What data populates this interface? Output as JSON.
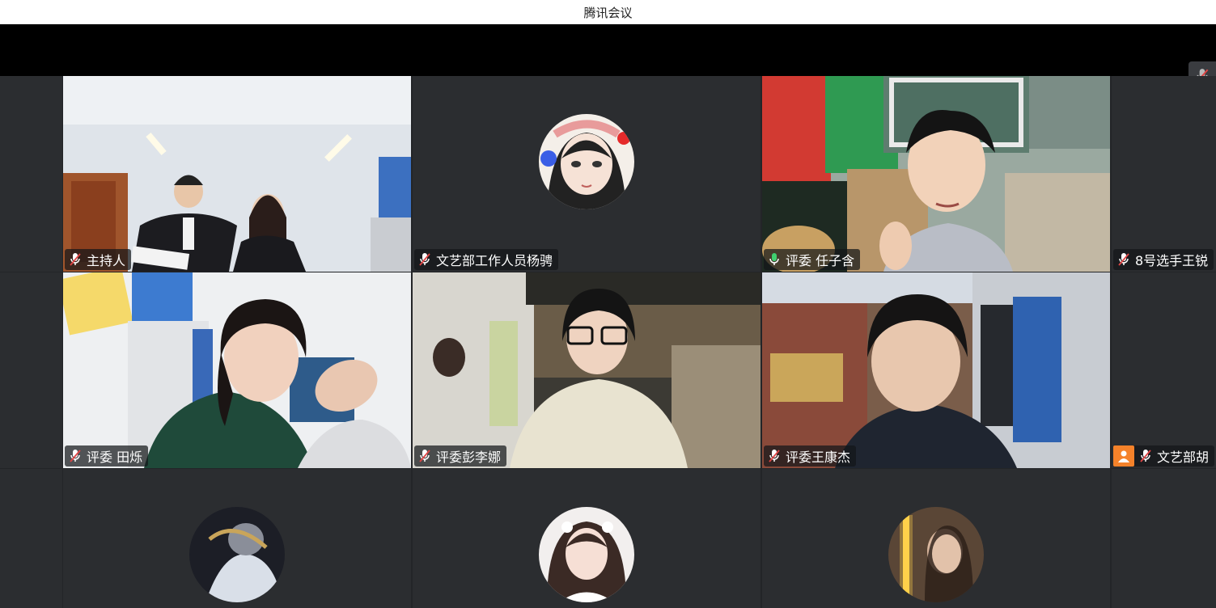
{
  "app": {
    "title": "腾讯会议"
  },
  "colors": {
    "speaking": "#2bbf6a",
    "muted": "#e04545",
    "unmuted": "#3fcf6f",
    "orange": "#f5822a"
  },
  "participants": [
    {
      "name": "主持人",
      "mic": "muted",
      "video": true
    },
    {
      "name": "文艺部工作人员杨骋",
      "mic": "muted",
      "video": false
    },
    {
      "name": "评委 任子含",
      "mic": "on",
      "video": true,
      "speaking": true
    },
    {
      "name": "8号选手王锐",
      "mic": "muted",
      "video": false
    },
    {
      "name": "评委 田烁",
      "mic": "muted",
      "video": true
    },
    {
      "name": "评委彭李娜",
      "mic": "muted",
      "video": true
    },
    {
      "name": "评委王康杰",
      "mic": "muted",
      "video": true
    },
    {
      "name": "文艺部胡",
      "mic": "muted",
      "video": false
    },
    {
      "name": "",
      "mic": "",
      "video": false
    },
    {
      "name": "",
      "mic": "",
      "video": false
    },
    {
      "name": "",
      "mic": "",
      "video": false
    }
  ]
}
